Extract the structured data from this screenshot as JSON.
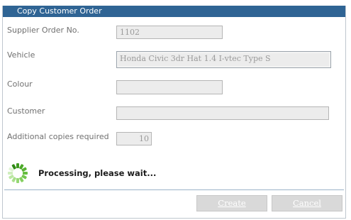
{
  "dialog": {
    "title": "Copy Customer Order"
  },
  "form": {
    "supplier_order_label": "Supplier Order No.",
    "supplier_order_value": "1102",
    "vehicle_label": "Vehicle",
    "vehicle_value": "Honda Civic 3dr Hat 1.4 I-vtec Type S",
    "colour_label": "Colour",
    "colour_value": "",
    "customer_label": "Customer",
    "customer_value": "",
    "copies_label": "Additional copies required",
    "copies_value": "10"
  },
  "status": {
    "message": "Processing, please wait...",
    "spinner_icon": "loading-spinner-icon",
    "spinner_color": "#5cb531"
  },
  "buttons": {
    "create_label": "Create",
    "cancel_label": "Cancel"
  },
  "colors": {
    "titlebar": "#2f6494",
    "field_background": "#ececec"
  }
}
